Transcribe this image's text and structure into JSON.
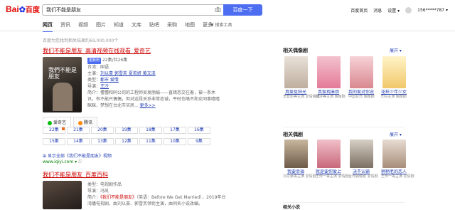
{
  "logo": {
    "left": "Bai",
    "right": "百度"
  },
  "search": {
    "value": "我们不能是朋友",
    "button": "百度一下"
  },
  "top": {
    "links": [
      "百度首页",
      "消息",
      "设置 ▾",
      "156*****787 ▾"
    ]
  },
  "tabs": [
    "网页",
    "资讯",
    "视频",
    "图片",
    "知道",
    "文库",
    "贴吧",
    "采购",
    "地图",
    "更多"
  ],
  "tools": "搜索工具",
  "count": "百度为您找到相关结果约69,000,000个",
  "result1": {
    "title": "我们不能是朋友_高清视频在线观看_爱奇艺",
    "poster_text": "我們不能是朋友",
    "badge": "更新到",
    "episodes": "22集/共26集",
    "rows": [
      {
        "k": "台湾：",
        "v": "国语"
      },
      {
        "k": "主演：",
        "v": "刘以豪  郭雪芙  夏若妍  黄文泽"
      },
      {
        "k": "类型：",
        "v": "都市  爱情"
      },
      {
        "k": "导演：",
        "v": "王冷"
      }
    ],
    "intro_label": "简介：",
    "intro": "懂懂和同公司的工程师吴发丽娟——直暗恋交往着，被一条木讯，有不能只偶偶，但对这段关系非常态诚，平时也咯不和女同事嘻嘻眯眯，梦想在台北市买房...",
    "more": "更多>>",
    "source_tabs": [
      "爱奇艺",
      "腾讯"
    ],
    "ep_labels": [
      "22集",
      "21集",
      "20集",
      "19集",
      "18集",
      "17集",
      "16集",
      "15集",
      "14集",
      "13集",
      "12集",
      "11集",
      "10集",
      "9集"
    ],
    "show_all": "显示全部《我们不能是朋友》视频",
    "url": "www.iqiyi.com"
  },
  "result2": {
    "title": "我们不能是朋友_百度百科",
    "rows": [
      {
        "k": "类型：",
        "v": "电视剧作品"
      },
      {
        "k": "导演：",
        "v": "冯凯"
      }
    ],
    "intro_a": "简介：",
    "intro_em": "《我们不能是朋友》",
    "intro_b": "（英语：Before We Get Married），2019年台湾播电视剧。由刘以豪、郭雪芙领衔主演，由同名小说改编。"
  },
  "right1": {
    "head": "相关偶像剧",
    "more": "展开 ▾",
    "items": [
      {
        "name": "真爱挺阳光",
        "sub": "李智凯等主演 爱情偶像"
      },
      {
        "name": "真爱找麻烦",
        "sub": "邱泽等主演 偶像剧"
      },
      {
        "name": "我的爱对你说",
        "sub": "中国台湾 偶像剧"
      },
      {
        "name": "花样少年少女",
        "sub": "Ella主演 偶像剧"
      }
    ]
  },
  "right2": {
    "head": "相关偶剧",
    "more": "展开 ▾",
    "items": [
      {
        "name": "我要幸福",
        "sub": "刘以豪等主演 爱情剧"
      },
      {
        "name": "就是要你爱上我",
        "sub": "王传一等主演 爱情剧"
      },
      {
        "name": "决不认输",
        "sub": "台湾偶像剧 爱情剧"
      },
      {
        "name": "稍稍老的恋人",
        "sub": "王传一等主演 爱情剧"
      }
    ]
  },
  "right3": {
    "head": "相关小说"
  },
  "colors": {
    "accent": "#4e6ef2",
    "link": "#2440b3",
    "title_red": "#cc0000",
    "url_green": "#008000"
  }
}
